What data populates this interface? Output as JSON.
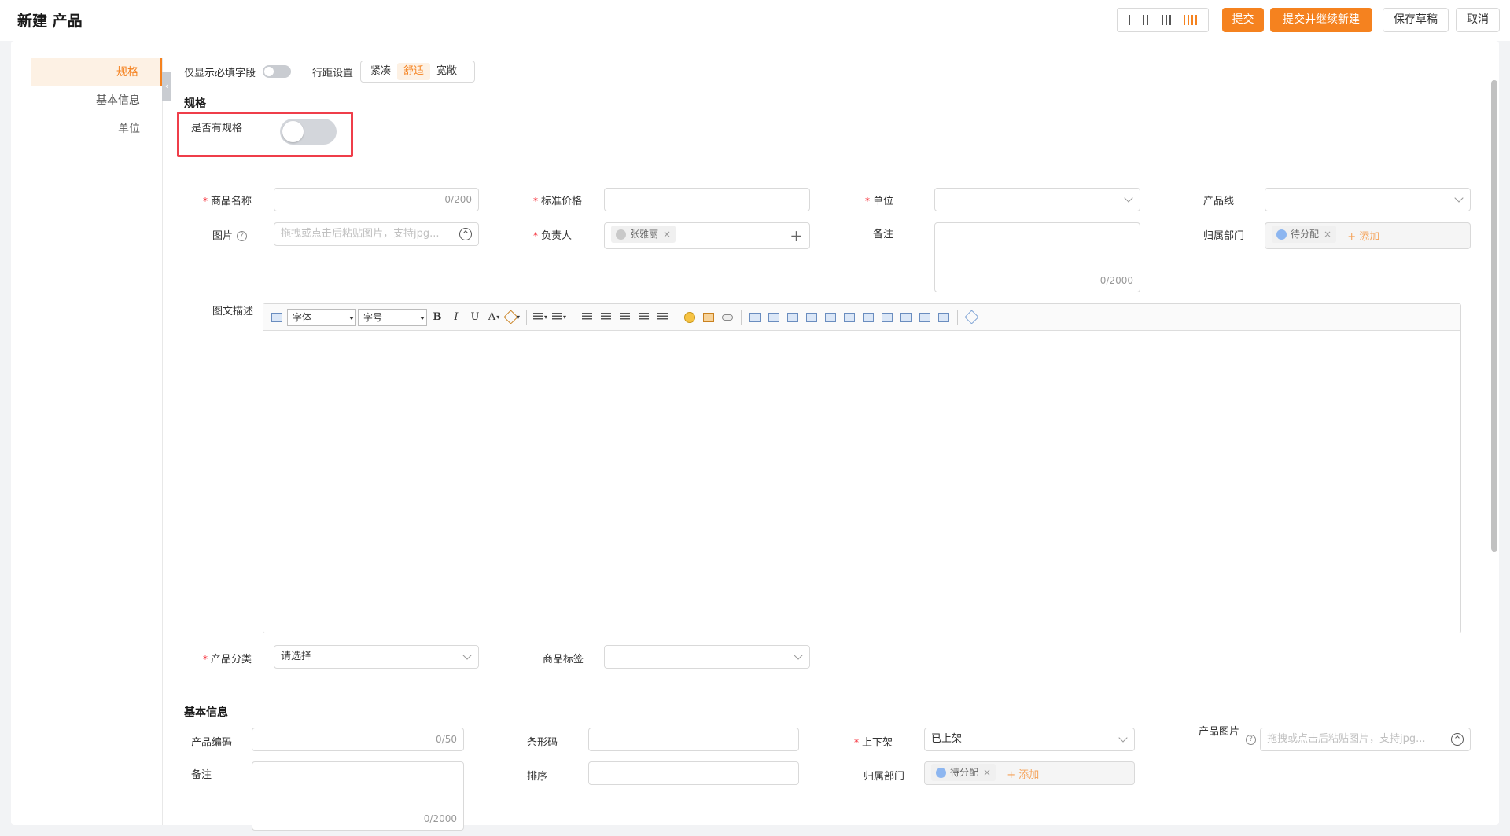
{
  "page_title": "新建 产品",
  "header": {
    "column_switch": [
      "I",
      "II",
      "III",
      "IIII"
    ],
    "submit": "提交",
    "submit_continue": "提交并继续新建",
    "save_draft": "保存草稿",
    "cancel": "取消"
  },
  "colors": {
    "accent": "#f5821f",
    "required": "#f5222d",
    "highlight": "#ef3e4a"
  },
  "anchor_nav": [
    "规格",
    "基本信息",
    "单位"
  ],
  "toolbar_row": {
    "required_only_label": "仅显示必填字段",
    "row_spacing_label": "行距设置",
    "spacing_options": [
      "紧凑",
      "舒适",
      "宽敞"
    ],
    "spacing_selected": "舒适"
  },
  "spec_section": {
    "title": "规格",
    "has_spec_label": "是否有规格",
    "has_spec_value": false
  },
  "form": {
    "name_label": "商品名称",
    "name_counter": "0/200",
    "price_label": "标准价格",
    "unit_label": "单位",
    "line_label": "产品线",
    "image_label": "图片",
    "image_placeholder": "拖拽或点击后粘贴图片，支持jpg...",
    "owner_label": "负责人",
    "owner_tag": "张雅丽",
    "remark_label": "备注",
    "remark_counter": "0/2000",
    "dept_label": "归属部门",
    "dept_tag": "待分配",
    "add_text": "+ 添加",
    "desc_label": "图文描述",
    "category_label": "产品分类",
    "category_value": "请选择",
    "tags_label": "商品标签"
  },
  "editor": {
    "font_select": "字体",
    "size_select": "字号",
    "bold": "B",
    "italic": "I",
    "underline": "U",
    "font_color": "A"
  },
  "basic_section": {
    "title": "基本信息",
    "code_label": "产品编码",
    "code_counter": "0/50",
    "barcode_label": "条形码",
    "shelf_label": "上下架",
    "shelf_value": "已上架",
    "product_image_label": "产品图片",
    "product_image_placeholder": "拖拽或点击后粘贴图片，支持jpg...",
    "remark_label": "备注",
    "remark_counter": "0/2000",
    "sort_label": "排序",
    "dept_label": "归属部门",
    "dept_tag": "待分配",
    "add_text": "+ 添加"
  }
}
